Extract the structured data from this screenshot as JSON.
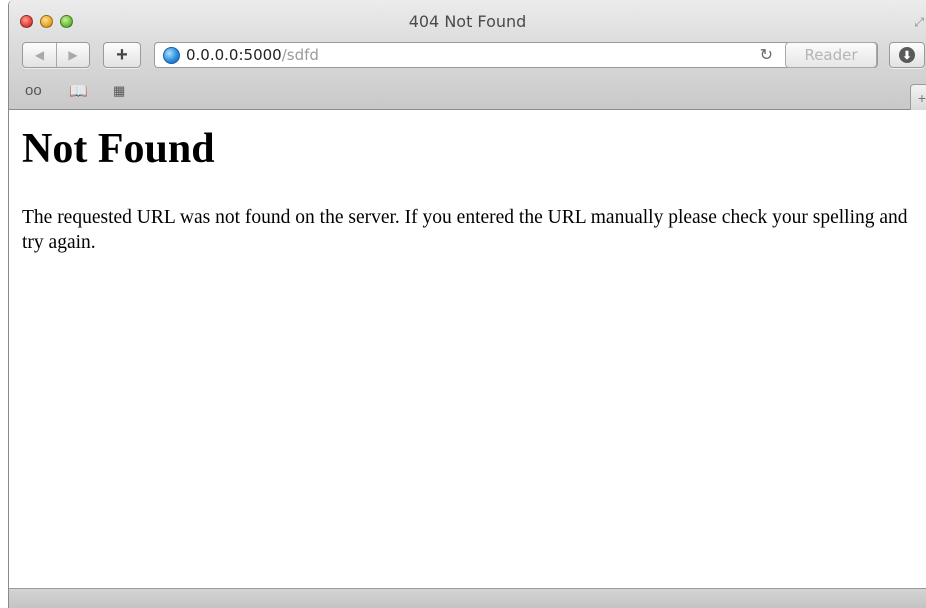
{
  "window": {
    "title": "404 Not Found"
  },
  "toolbar": {
    "back_icon": "◀",
    "forward_icon": "▶",
    "add_label": "+",
    "reader_label": "Reader",
    "reload_icon": "↻",
    "download_icon": "⬇",
    "fullscreen_icon": "⤢",
    "newtab_label": "+"
  },
  "address_bar": {
    "host": "0.0.0.0:5000",
    "path": "/sdfd"
  },
  "bookmarks_bar": {
    "reading_list_icon": "oo",
    "bookmarks_icon": "📖",
    "top_sites_icon": "▦"
  },
  "page": {
    "title": "Not Found",
    "message": "The requested URL was not found on the server. If you entered the URL manually please check your spelling and try again."
  },
  "colors": {
    "close": "#e0443a",
    "minimize": "#e8a72a",
    "zoom": "#6cbf3a",
    "url_path": "#9a9a9a"
  }
}
